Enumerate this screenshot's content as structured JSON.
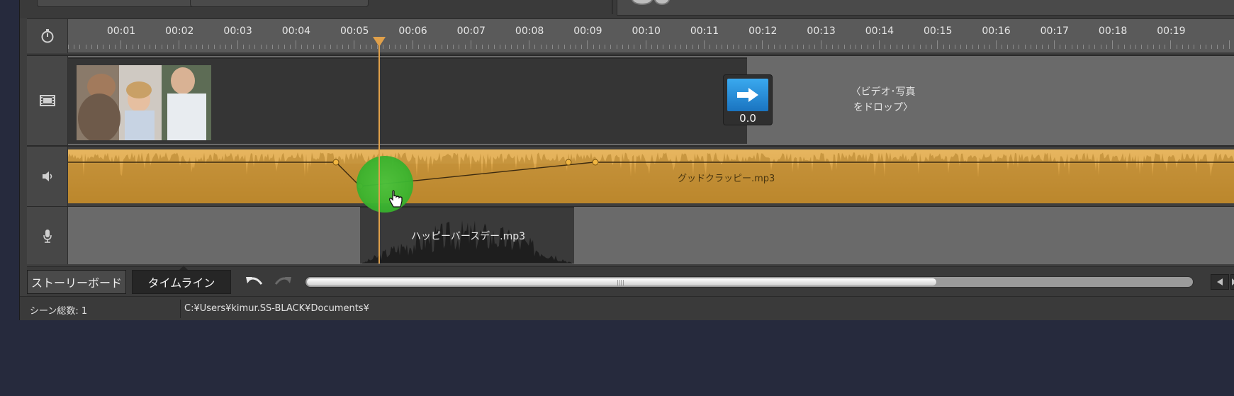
{
  "ruler": {
    "labels": [
      "00:01",
      "00:02",
      "00:03",
      "00:04",
      "00:05",
      "00:06",
      "00:07",
      "00:08",
      "00:09",
      "00:10",
      "00:11",
      "00:12",
      "00:13",
      "00:14",
      "00:15",
      "00:16",
      "00:17",
      "00:18",
      "00:19"
    ]
  },
  "video_track": {
    "transition_value": "0.0",
    "drop_hint_line1": "〈ビデオ･写真",
    "drop_hint_line2": "をドロップ〉"
  },
  "audio_track": {
    "clip_name": "グッドクラッピー.mp3"
  },
  "narration_track": {
    "clip_name": "ハッピーバースデー.mp3"
  },
  "tabs": {
    "storyboard": "ストーリーボード",
    "timeline": "タイムライン"
  },
  "status": {
    "scene_count": "シーン総数: 1",
    "path": "C:¥Users¥kimur.SS-BLACK¥Documents¥"
  },
  "colors": {
    "audio_clip": "#d9a346",
    "playhead": "#e0a04a",
    "cursor_highlight": "#3ab52f",
    "transition_blue": "#2a8fdb"
  }
}
